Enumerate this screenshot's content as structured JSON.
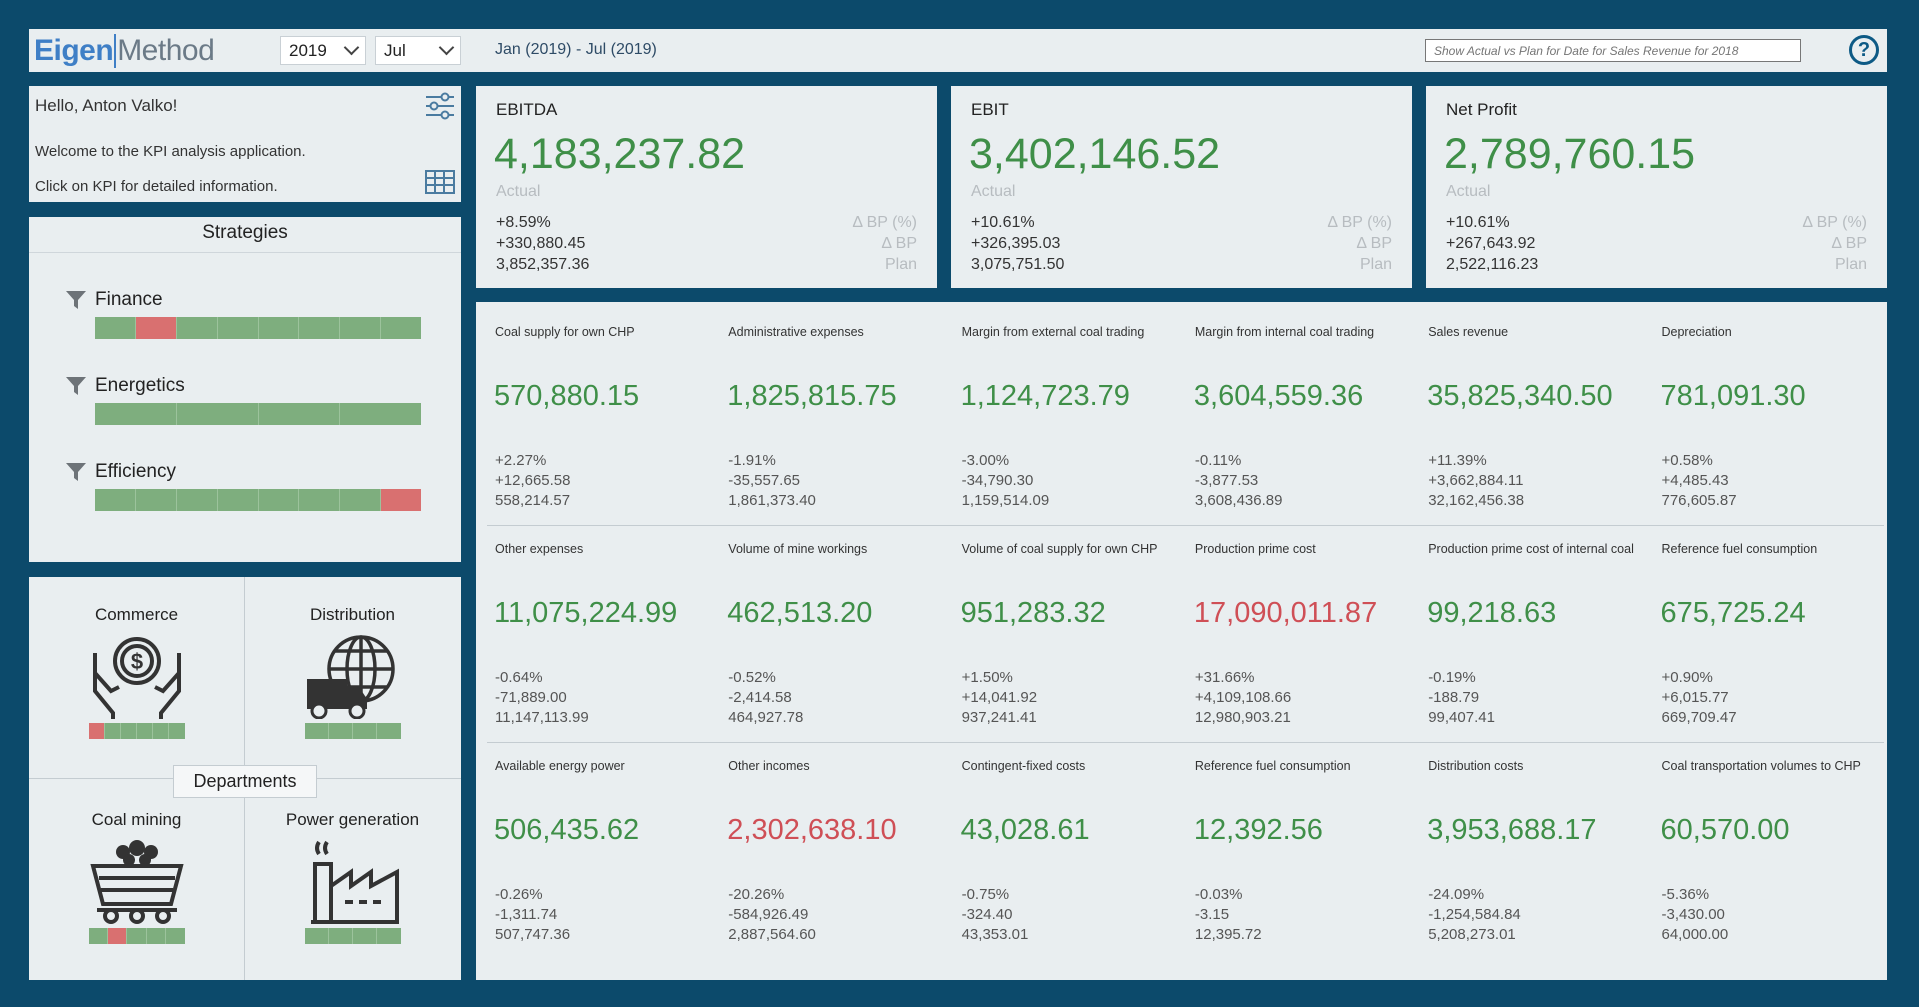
{
  "header": {
    "logo_part1": "Eigen",
    "logo_part2": "Method",
    "year": "2019",
    "month": "Jul",
    "range": "Jan (2019) - Jul (2019)",
    "search_placeholder": "Show Actual vs Plan for Date for Sales Revenue for 2018"
  },
  "welcome": {
    "greeting": "Hello, Anton Valko!",
    "line1": "Welcome to the KPI analysis application.",
    "line2": "Click on KPI for detailed information."
  },
  "strategies": {
    "title": "Strategies",
    "items": [
      {
        "name": "Finance",
        "segments": [
          "green",
          "red",
          "green",
          "green",
          "green",
          "green",
          "green",
          "green"
        ]
      },
      {
        "name": "Energetics",
        "segments": [
          "green",
          "green",
          "green",
          "green"
        ]
      },
      {
        "name": "Efficiency",
        "segments": [
          "green",
          "green",
          "green",
          "green",
          "green",
          "green",
          "green",
          "red"
        ]
      }
    ]
  },
  "departments": {
    "label": "Departments",
    "items": [
      {
        "name": "Commerce",
        "icon": "money-hands-icon",
        "segments": [
          "red",
          "green",
          "green",
          "green",
          "green",
          "green"
        ]
      },
      {
        "name": "Distribution",
        "icon": "delivery-globe-icon",
        "segments": [
          "green",
          "green",
          "green",
          "green"
        ]
      },
      {
        "name": "Coal mining",
        "icon": "coal-cart-icon",
        "segments": [
          "green",
          "red",
          "green",
          "green",
          "green"
        ]
      },
      {
        "name": "Power generation",
        "icon": "factory-icon",
        "segments": [
          "green",
          "green",
          "green",
          "green"
        ]
      }
    ]
  },
  "top_kpis": [
    {
      "name": "EBITDA",
      "value": "4,183,237.82",
      "actual_label": "Actual",
      "bp_pct": "+8.59%",
      "delta_bp": "+330,880.45",
      "plan": "3,852,357.36"
    },
    {
      "name": "EBIT",
      "value": "3,402,146.52",
      "actual_label": "Actual",
      "bp_pct": "+10.61%",
      "delta_bp": "+326,395.03",
      "plan": "3,075,751.50"
    },
    {
      "name": "Net Profit",
      "value": "2,789,760.15",
      "actual_label": "Actual",
      "bp_pct": "+10.61%",
      "delta_bp": "+267,643.92",
      "plan": "2,522,116.23"
    }
  ],
  "top_kpi_labels": {
    "bp_pct": "Δ BP (%)",
    "delta_bp": "Δ BP",
    "plan": "Plan"
  },
  "kpis": [
    {
      "name": "Coal supply for own CHP",
      "value": "570,880.15",
      "status": "good",
      "pct": "+2.27%",
      "delta": "+12,665.58",
      "plan": "558,214.57"
    },
    {
      "name": "Administrative expenses",
      "value": "1,825,815.75",
      "status": "good",
      "pct": "-1.91%",
      "delta": "-35,557.65",
      "plan": "1,861,373.40"
    },
    {
      "name": "Margin from external coal trading",
      "value": "1,124,723.79",
      "status": "good",
      "pct": "-3.00%",
      "delta": "-34,790.30",
      "plan": "1,159,514.09"
    },
    {
      "name": "Margin from internal coal trading",
      "value": "3,604,559.36",
      "status": "good",
      "pct": "-0.11%",
      "delta": "-3,877.53",
      "plan": "3,608,436.89"
    },
    {
      "name": "Sales revenue",
      "value": "35,825,340.50",
      "status": "good",
      "pct": "+11.39%",
      "delta": "+3,662,884.11",
      "plan": "32,162,456.38"
    },
    {
      "name": "Depreciation",
      "value": "781,091.30",
      "status": "good",
      "pct": "+0.58%",
      "delta": "+4,485.43",
      "plan": "776,605.87"
    },
    {
      "name": "Other expenses",
      "value": "11,075,224.99",
      "status": "good",
      "pct": "-0.64%",
      "delta": "-71,889.00",
      "plan": "11,147,113.99"
    },
    {
      "name": "Volume of mine workings",
      "value": "462,513.20",
      "status": "good",
      "pct": "-0.52%",
      "delta": "-2,414.58",
      "plan": "464,927.78"
    },
    {
      "name": "Volume of coal supply for own CHP",
      "value": "951,283.32",
      "status": "good",
      "pct": "+1.50%",
      "delta": "+14,041.92",
      "plan": "937,241.41"
    },
    {
      "name": "Production prime cost",
      "value": "17,090,011.87",
      "status": "bad",
      "pct": "+31.66%",
      "delta": "+4,109,108.66",
      "plan": "12,980,903.21"
    },
    {
      "name": "Production prime cost of internal coal",
      "value": "99,218.63",
      "status": "good",
      "pct": "-0.19%",
      "delta": "-188.79",
      "plan": "99,407.41"
    },
    {
      "name": "Reference fuel consumption",
      "value": "675,725.24",
      "status": "good",
      "pct": "+0.90%",
      "delta": "+6,015.77",
      "plan": "669,709.47"
    },
    {
      "name": "Available energy power",
      "value": "506,435.62",
      "status": "good",
      "pct": "-0.26%",
      "delta": "-1,311.74",
      "plan": "507,747.36"
    },
    {
      "name": "Other incomes",
      "value": "2,302,638.10",
      "status": "bad",
      "pct": "-20.26%",
      "delta": "-584,926.49",
      "plan": "2,887,564.60"
    },
    {
      "name": "Contingent-fixed costs",
      "value": "43,028.61",
      "status": "good",
      "pct": "-0.75%",
      "delta": "-324.40",
      "plan": "43,353.01"
    },
    {
      "name": "Reference fuel consumption",
      "value": "12,392.56",
      "status": "good",
      "pct": "-0.03%",
      "delta": "-3.15",
      "plan": "12,395.72"
    },
    {
      "name": "Distribution costs",
      "value": "3,953,688.17",
      "status": "good",
      "pct": "-24.09%",
      "delta": "-1,254,584.84",
      "plan": "5,208,273.01"
    },
    {
      "name": "Coal transportation volumes to CHP",
      "value": "60,570.00",
      "status": "good",
      "pct": "-5.36%",
      "delta": "-3,430.00",
      "plan": "64,000.00"
    }
  ],
  "colors": {
    "background": "#0c4a6b",
    "panel": "#e9eef0",
    "good": "#3f8f48",
    "bad": "#cf4f56",
    "bar_green": "#7eae7e",
    "bar_red": "#d97070",
    "accent": "#3f7fc6"
  }
}
